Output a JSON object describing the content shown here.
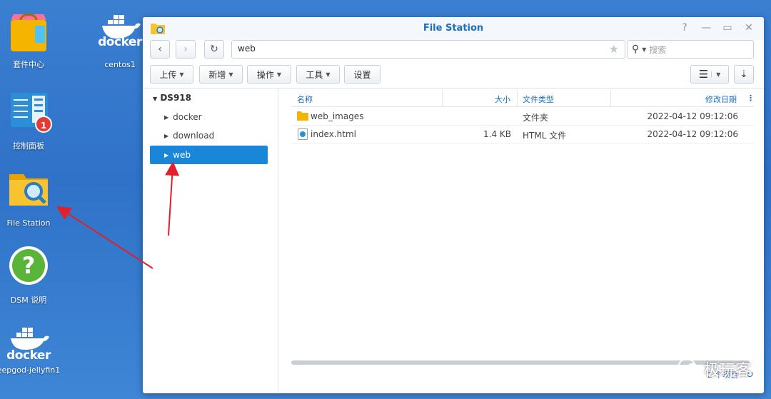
{
  "desktop": {
    "icons": [
      {
        "label": "套件中心"
      },
      {
        "label": "centos1"
      },
      {
        "label": "控制面板",
        "badge": "1"
      },
      {
        "label": "File Station"
      },
      {
        "label": "DSM 说明"
      },
      {
        "label": "eepgod-jellyfin1"
      }
    ],
    "docker_text": "docker"
  },
  "window": {
    "title": "File Station",
    "path": "web",
    "search_placeholder": "搜索",
    "toolbar": {
      "upload": "上传",
      "create": "新增",
      "action": "操作",
      "tools": "工具",
      "settings": "设置"
    },
    "tree": {
      "root": "DS918",
      "items": [
        {
          "label": "docker"
        },
        {
          "label": "download"
        },
        {
          "label": "web",
          "selected": true
        }
      ]
    },
    "columns": {
      "name": "名称",
      "size": "大小",
      "type": "文件类型",
      "modified": "修改日期"
    },
    "files": [
      {
        "name": "web_images",
        "size": "",
        "type": "文件夹",
        "modified": "2022-04-12 09:12:06"
      },
      {
        "name": "index.html",
        "size": "1.4 KB",
        "type": "HTML 文件",
        "modified": "2022-04-12 09:12:06"
      }
    ],
    "item_count": "2 个项目"
  },
  "watermark": "极玩客",
  "colors": {
    "accent": "#1a86d8",
    "title": "#1a6fc0",
    "desktop": "#3b7fd1",
    "annotation": "#e0202a"
  }
}
